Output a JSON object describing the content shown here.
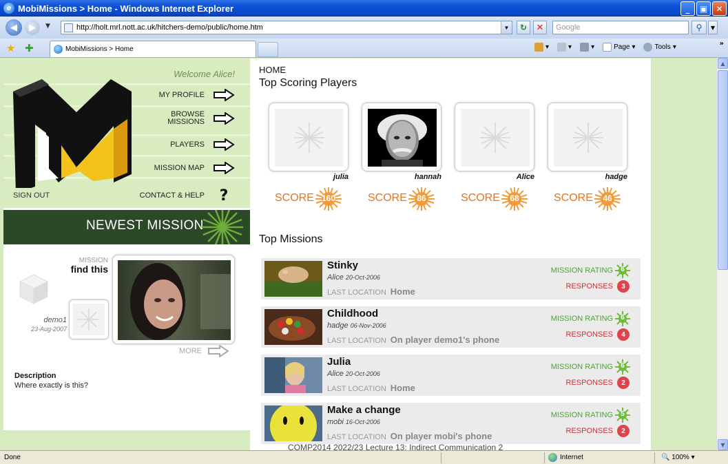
{
  "window": {
    "title": "MobiMissions > Home - Windows Internet Explorer",
    "minimize": "_",
    "restore": "▣",
    "close": "✕"
  },
  "address": {
    "url": "http://holt.mrl.nott.ac.uk/hitchers-demo/public/home.htm",
    "search_placeholder": "Google"
  },
  "tabs": {
    "active_label": "MobiMissions > Home",
    "commands": [
      "Page",
      "Tools"
    ]
  },
  "sidebar": {
    "welcome": "Welcome Alice!",
    "menu": [
      "MY PROFILE",
      "BROWSE MISSIONS",
      "PLAYERS",
      "MISSION MAP",
      "CONTACT & HELP"
    ],
    "sign_out": "SIGN OUT",
    "newest_title": "NEWEST MISSION",
    "newest": {
      "label": "MISSION",
      "title": "find this",
      "user": "demo1",
      "date": "23-Aug-2007",
      "more": "MORE",
      "desc_title": "Description",
      "desc_text": "Where exactly is this?"
    }
  },
  "main": {
    "breadcrumb": "HOME",
    "top_players_title": "Top Scoring Players",
    "score_word": "SCORE",
    "players": [
      {
        "name": "julia",
        "score": "160"
      },
      {
        "name": "hannah",
        "score": "86"
      },
      {
        "name": "Alice",
        "score": "68"
      },
      {
        "name": "hadge",
        "score": "46"
      }
    ],
    "top_missions_title": "Top Missions",
    "rating_label": "MISSION RATING",
    "responses_label": "RESPONSES",
    "location_label": "LAST LOCATION",
    "missions": [
      {
        "title": "Stinky",
        "author": "Alice",
        "date": "20-Oct-2006",
        "location": "Home",
        "rating": "6",
        "responses": "3"
      },
      {
        "title": "Childhood",
        "author": "hadge",
        "date": "06-Nov-2006",
        "location": "On player demo1's phone",
        "rating": "6",
        "responses": "4"
      },
      {
        "title": "Julia",
        "author": "Alice",
        "date": "20-Oct-2006",
        "location": "Home",
        "rating": "6",
        "responses": "2"
      },
      {
        "title": "Make a change",
        "author": "mobi",
        "date": "16-Oct-2006",
        "location": "On player mobi's phone",
        "rating": "5",
        "responses": "2"
      }
    ]
  },
  "status": {
    "text": "Done",
    "caption": "COMP2014 2022/23 Lecture 13: Indirect Communication 2",
    "zone": "Internet",
    "zoom": "100%"
  }
}
